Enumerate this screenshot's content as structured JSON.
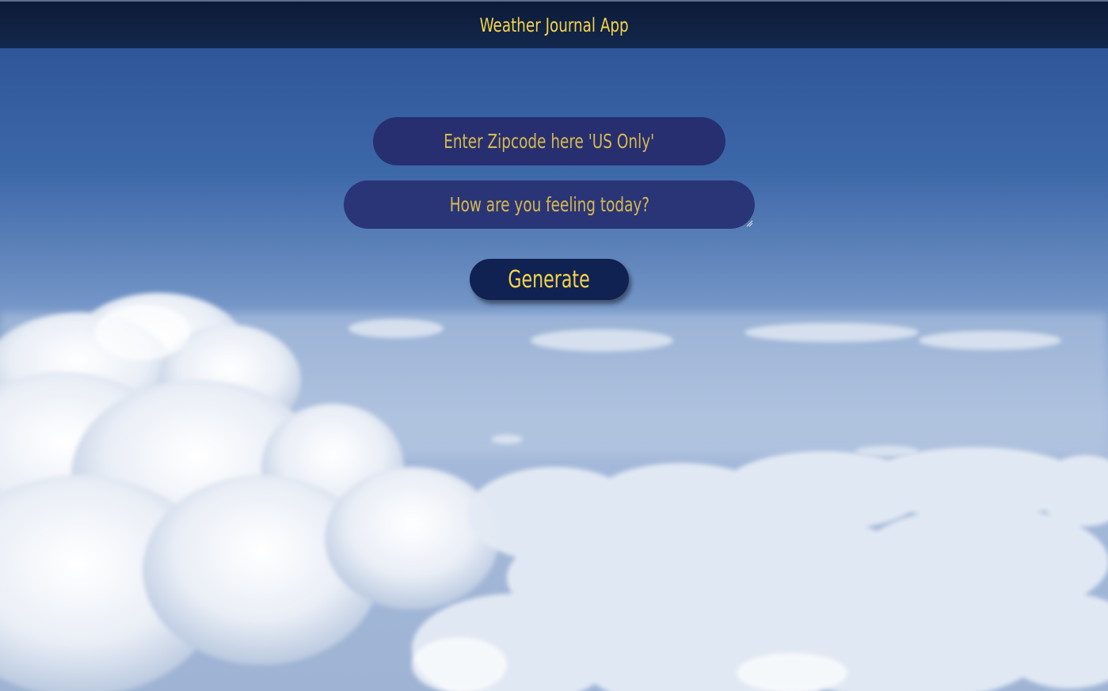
{
  "header": {
    "title": "Weather Journal App"
  },
  "form": {
    "zip_placeholder": "Enter Zipcode here 'US Only'",
    "feelings_placeholder": "How are you feeling today?",
    "generate_label": "Generate"
  },
  "colors": {
    "accent_text": "#f4d24a",
    "header_bg": "#0c1a38",
    "input_bg": "#272f70",
    "button_bg": "#102252"
  }
}
